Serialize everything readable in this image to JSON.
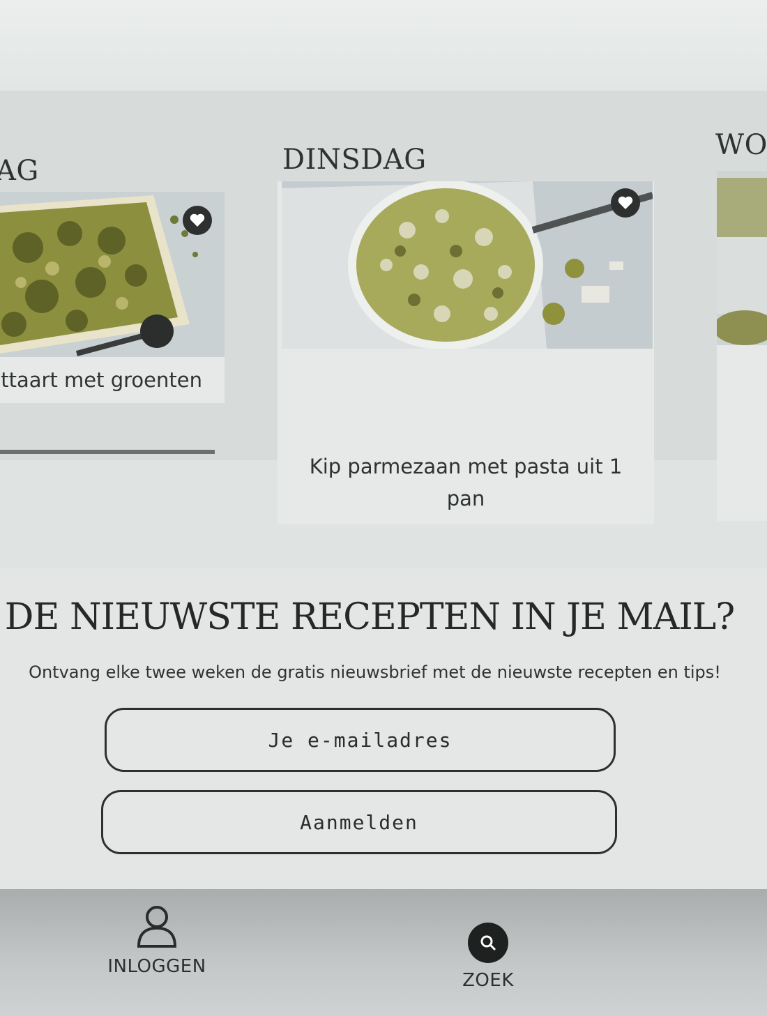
{
  "carousel": {
    "days": [
      {
        "label": "AG",
        "recipe_title": "ttaart met groenten"
      },
      {
        "label": "DINSDAG",
        "recipe_title": "Kip parmezaan met pasta uit 1 pan"
      },
      {
        "label": "WO",
        "recipe_title": ""
      }
    ]
  },
  "newsletter": {
    "title": "DE NIEUWSTE RECEPTEN IN JE MAIL?",
    "subtitle": "Ontvang elke twee weken de gratis nieuwsbrief met de nieuwste recepten en tips!",
    "email_placeholder": "Je e-mailadres",
    "submit_label": "Aanmelden"
  },
  "bottom_nav": {
    "login": {
      "label": "INLOGGEN",
      "icon": "user-icon"
    },
    "search": {
      "label": "ZOEK",
      "icon": "search-icon"
    }
  },
  "colors": {
    "background": "#dfe3e2",
    "text": "#2b2d2d",
    "nav_bar": "#b4b8b8",
    "heart_badge": "#2e2f2f"
  }
}
